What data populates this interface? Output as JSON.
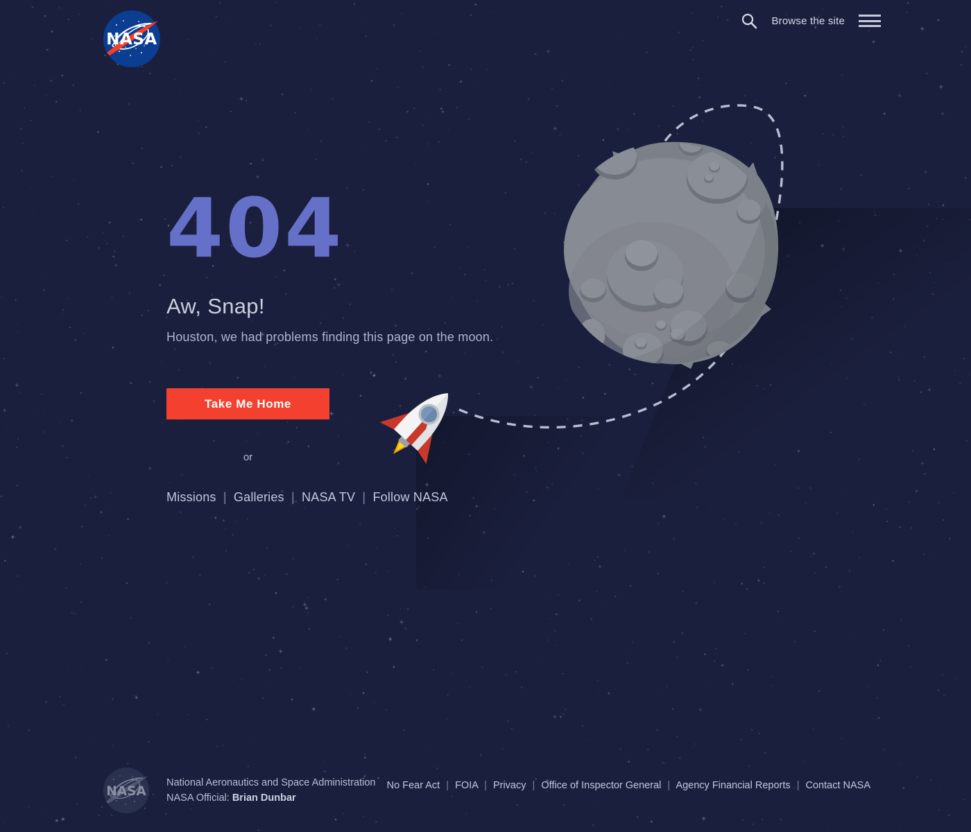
{
  "header": {
    "logo_alt": "NASA",
    "search_icon": "search-icon",
    "browse_label": "Browse the site",
    "menu_icon": "hamburger-menu-icon"
  },
  "main": {
    "error_code": "404",
    "headline": "Aw, Snap!",
    "subtext": "Houston, we had problems finding this page on the moon.",
    "cta_label": "Take Me Home",
    "or_label": "or",
    "quick_links": [
      {
        "label": "Missions"
      },
      {
        "label": "Galleries"
      },
      {
        "label": "NASA TV"
      },
      {
        "label": "Follow NASA"
      }
    ],
    "separator": "|"
  },
  "illustration": {
    "moon_alt": "moon",
    "rocket_alt": "rocket",
    "trajectory_alt": "dashed-flight-path"
  },
  "footer": {
    "logo_alt": "NASA",
    "agency_name": "National Aeronautics and Space Administration",
    "official_label": "NASA Official:",
    "official_name": "Brian Dunbar",
    "links": [
      {
        "label": "No Fear Act"
      },
      {
        "label": "FOIA"
      },
      {
        "label": "Privacy"
      },
      {
        "label": "Office of Inspector General"
      },
      {
        "label": "Agency Financial Reports"
      },
      {
        "label": "Contact NASA"
      }
    ],
    "separator": "|"
  },
  "colors": {
    "background": "#1a1f3d",
    "error_code": "#6571c9",
    "cta_background": "#f4402e",
    "cta_text": "#ffffff",
    "moon_body": "#7c8088",
    "nasa_blue": "#0b3d91",
    "nasa_red": "#fc3d21"
  }
}
